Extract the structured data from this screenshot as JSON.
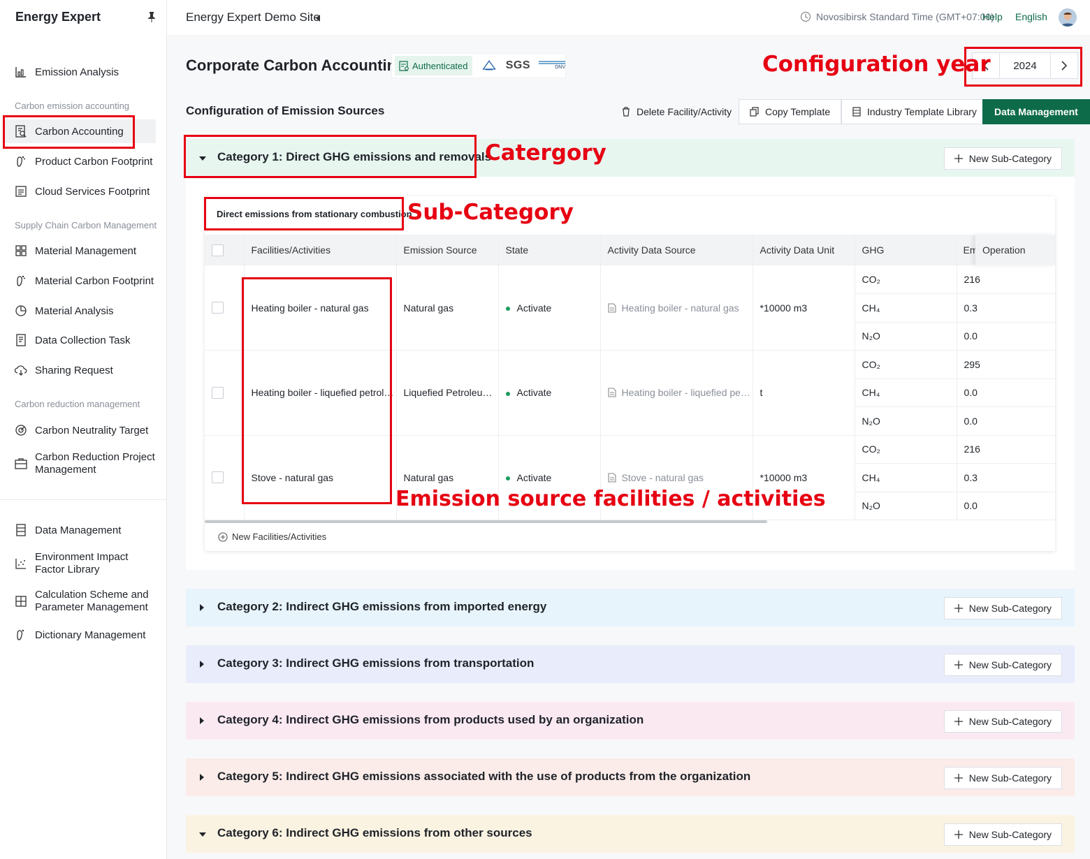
{
  "app": {
    "name": "Energy Expert",
    "site": "Energy Expert Demo Site",
    "timezone": "Novosibirsk Standard Time (GMT+07:00)",
    "help": "Help",
    "language": "English"
  },
  "sidebar": {
    "top": {
      "label": "Emission Analysis"
    },
    "section1": "Carbon emission accounting",
    "s1": [
      "Carbon Accounting",
      "Product Carbon Footprint",
      "Cloud Services Footprint"
    ],
    "section2": "Supply Chain Carbon Management",
    "s2": [
      "Material Management",
      "Material Carbon Footprint",
      "Material Analysis",
      "Data Collection Task",
      "Sharing Request"
    ],
    "section3": "Carbon reduction management",
    "s3": [
      "Carbon Neutrality Target",
      "Carbon Reduction Project Management"
    ],
    "s4": [
      "Data Management",
      "Environment Impact Factor Library",
      "Calculation Scheme and Parameter Management",
      "Dictionary Management"
    ]
  },
  "page": {
    "title": "Corporate Carbon Accounting",
    "authenticated": "Authenticated",
    "sgs": "SGS",
    "dnv": "DNV",
    "year": "2024",
    "section": "Configuration of Emission Sources"
  },
  "toolbar": {
    "delete": "Delete Facility/Activity",
    "copy": "Copy Template",
    "industry": "Industry Template Library",
    "data": "Data Management"
  },
  "new_sub": "New Sub-Category",
  "categories": [
    {
      "title": "Category 1: Direct GHG emissions and removals",
      "bg": "#e8f6f0"
    },
    {
      "title": "Category 2: Indirect GHG emissions from imported energy",
      "bg": "#e7f4fb"
    },
    {
      "title": "Category 3: Indirect GHG emissions from transportation",
      "bg": "#e9ecfb"
    },
    {
      "title": "Category 4: Indirect GHG emissions from products used by an organization",
      "bg": "#fbe9f2"
    },
    {
      "title": "Category 5: Indirect GHG emissions associated with the use of products from the organization",
      "bg": "#fbece9"
    },
    {
      "title": "Category 6: Indirect GHG emissions from other sources",
      "bg": "#fbf3e2"
    }
  ],
  "subcategory": {
    "title": "Direct emissions from stationary combustion",
    "columns": [
      "Facilities/Activities",
      "Emission Source",
      "State",
      "Activity Data Source",
      "Activity Data Unit",
      "GHG",
      "Em",
      "Operation"
    ],
    "rows": [
      {
        "facility": "Heating boiler - natural gas",
        "source": "Natural gas",
        "state": "Activate",
        "data_source": "Heating boiler - natural gas",
        "unit": "*10000 m3",
        "ghg": [
          "CO₂",
          "CH₄",
          "N₂O"
        ],
        "em": [
          "216",
          "0.3",
          "0.0"
        ]
      },
      {
        "facility": "Heating boiler - liquefied petroleum ...",
        "source": "Liquefied Petroleum G...",
        "state": "Activate",
        "data_source": "Heating boiler - liquefied petrol...",
        "unit": "t",
        "ghg": [
          "CO₂",
          "CH₄",
          "N₂O"
        ],
        "em": [
          "295",
          "0.0",
          "0.0"
        ]
      },
      {
        "facility": "Stove - natural gas",
        "source": "Natural gas",
        "state": "Activate",
        "data_source": "Stove - natural gas",
        "unit": "*10000 m3",
        "ghg": [
          "CO₂",
          "CH₄",
          "N₂O"
        ],
        "em": [
          "216",
          "0.3",
          "0.0"
        ]
      }
    ],
    "new_facility": "New Facilities/Activities"
  },
  "annotations": {
    "config_year": "Configuration year",
    "category": "Catergory",
    "sub_category": "Sub-Category",
    "facilities": "Emission source facilities / activities"
  }
}
